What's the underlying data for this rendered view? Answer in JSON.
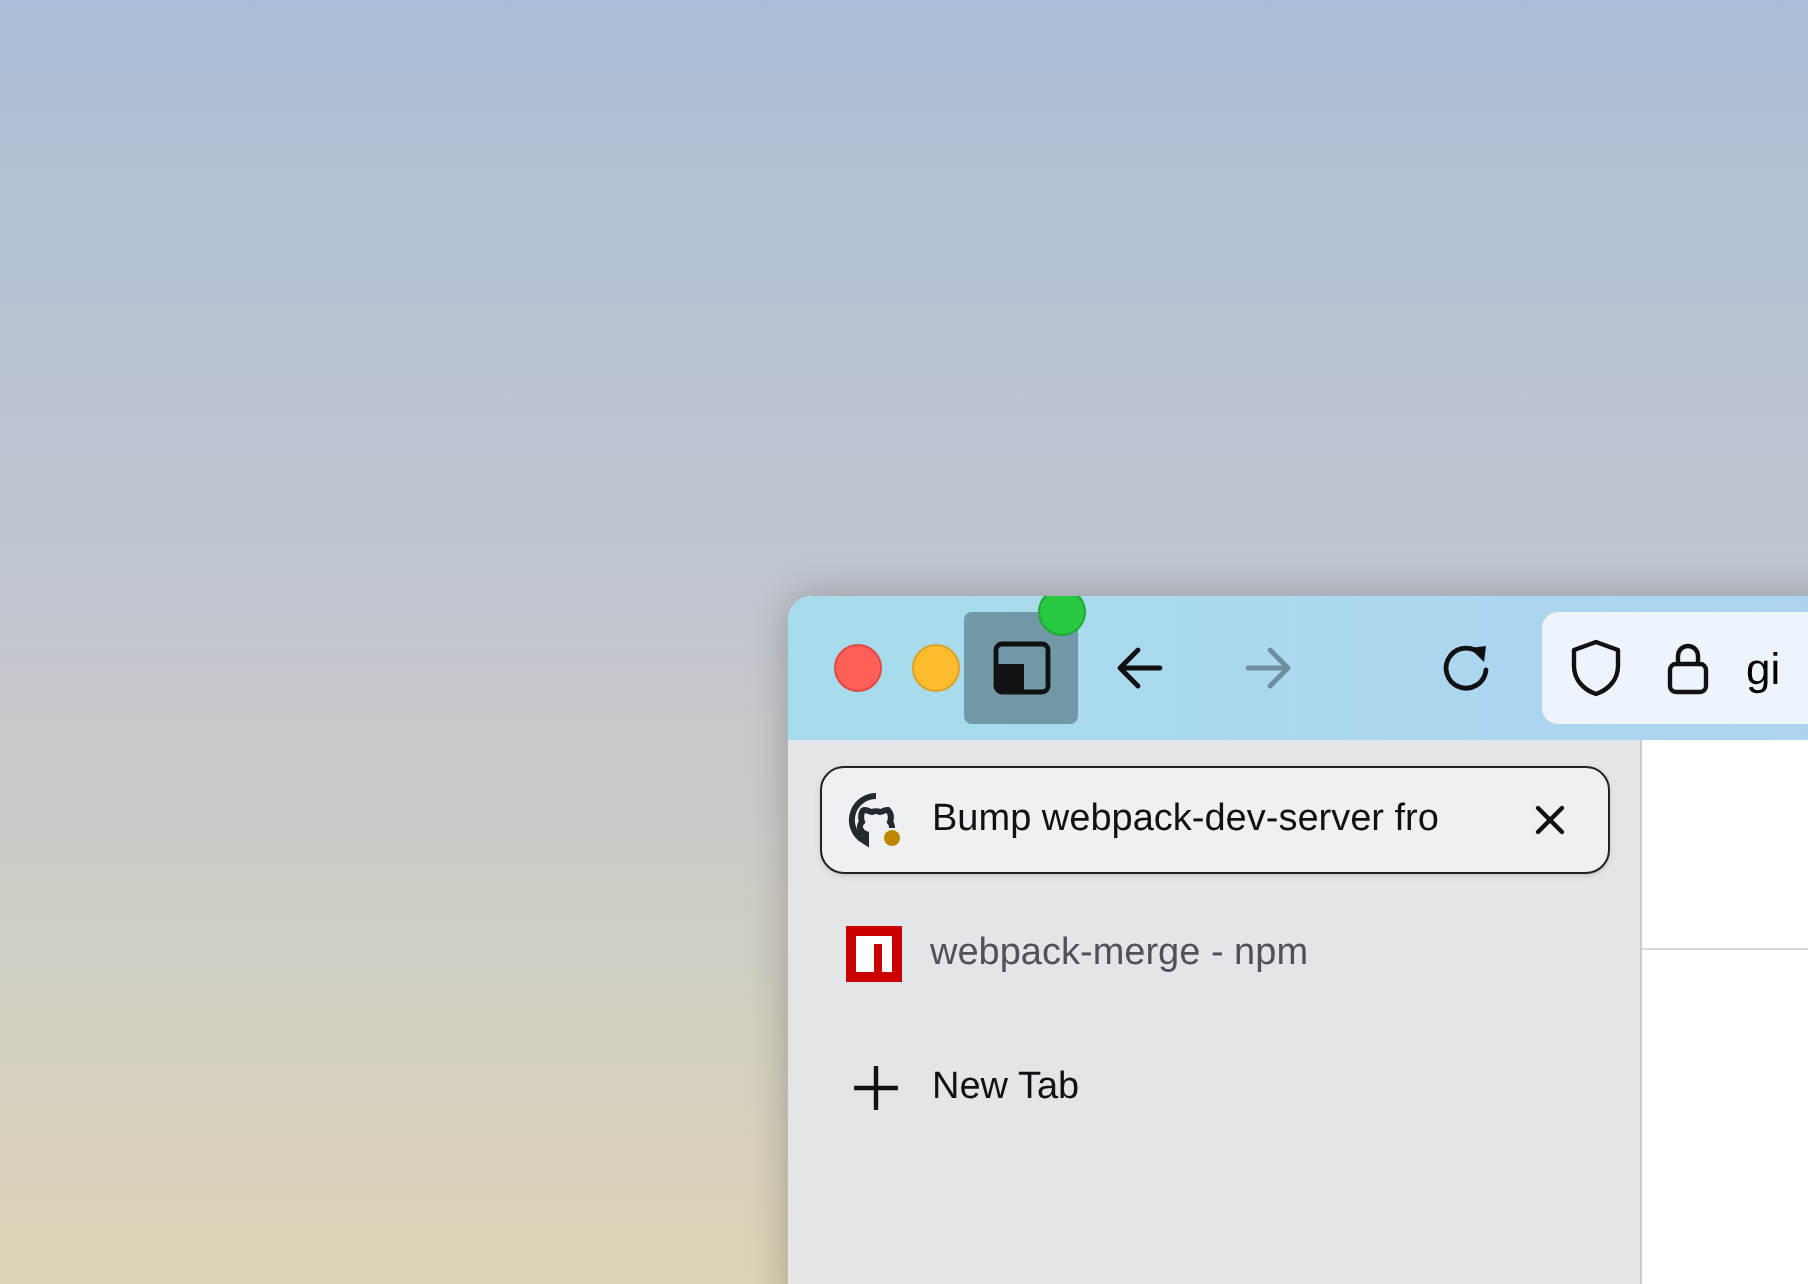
{
  "toolbar": {
    "sidebar_toggle": {
      "on": true
    },
    "nav_buttons": [
      {
        "kind": "back",
        "disabled": false
      },
      {
        "kind": "forward",
        "disabled": true
      },
      {
        "kind": "reload",
        "disabled": false
      }
    ],
    "address": {
      "value": "gi"
    }
  },
  "tabs": [
    {
      "title": "Bump webpack-dev-server fro",
      "kind": "github",
      "selected": true
    },
    {
      "title": "webpack-merge - npm",
      "kind": "npm",
      "selected": false
    }
  ],
  "new_tab": {
    "label": "New Tab"
  }
}
